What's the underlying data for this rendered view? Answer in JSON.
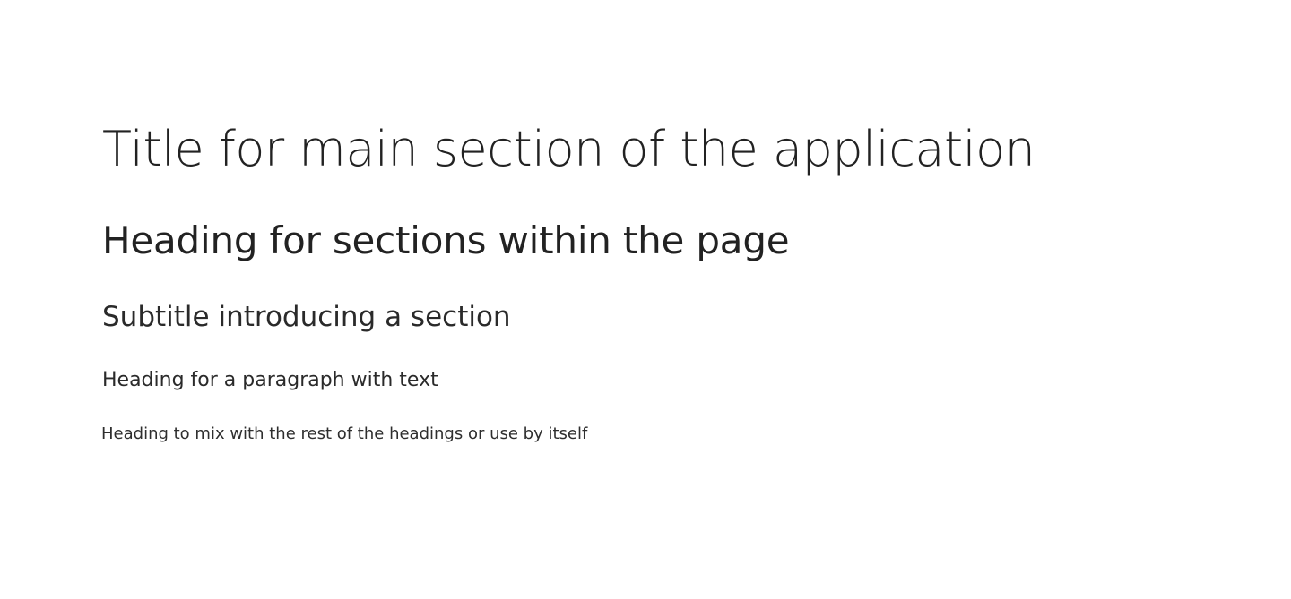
{
  "headings": {
    "h1": "Title for main section of the application",
    "h2": "Heading for sections within the page",
    "h3": "Subtitle introducing a section",
    "h4": "Heading for a paragraph with text",
    "h5": "Heading to mix with the rest of the headings or use by itself"
  },
  "colors": {
    "background": "#ffffff",
    "text": "#222222"
  }
}
